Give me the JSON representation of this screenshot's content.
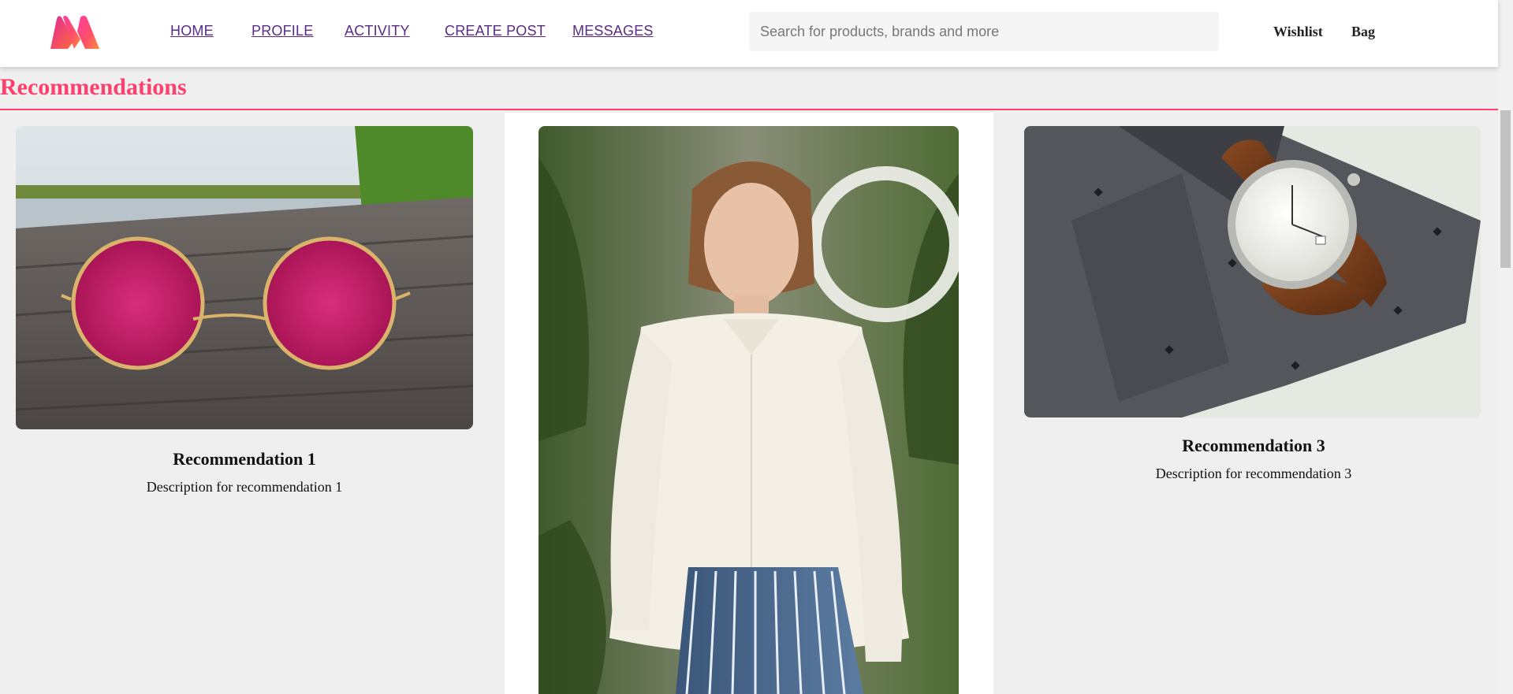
{
  "header": {
    "logo_icon": "myntra-logo-icon",
    "nav": [
      {
        "label": "HOME"
      },
      {
        "label": "PROFILE"
      },
      {
        "label": "ACTIVITY"
      },
      {
        "label": "CREATE POST"
      },
      {
        "label": "MESSAGES"
      }
    ],
    "search": {
      "placeholder": "Search for products, brands and more",
      "value": ""
    },
    "wishlist_label": "Wishlist",
    "bag_label": "Bag"
  },
  "recommendations": {
    "title": "Recommendations",
    "accent_color": "#ff3f6c",
    "cards": [
      {
        "title": "Recommendation 1",
        "description": "Description for recommendation 1",
        "image": "pink-sunglasses-photo"
      },
      {
        "title": "",
        "description": "",
        "image": "woman-white-blouse-photo"
      },
      {
        "title": "Recommendation 3",
        "description": "Description for recommendation 3",
        "image": "wristwatch-on-tie-photo"
      }
    ]
  }
}
